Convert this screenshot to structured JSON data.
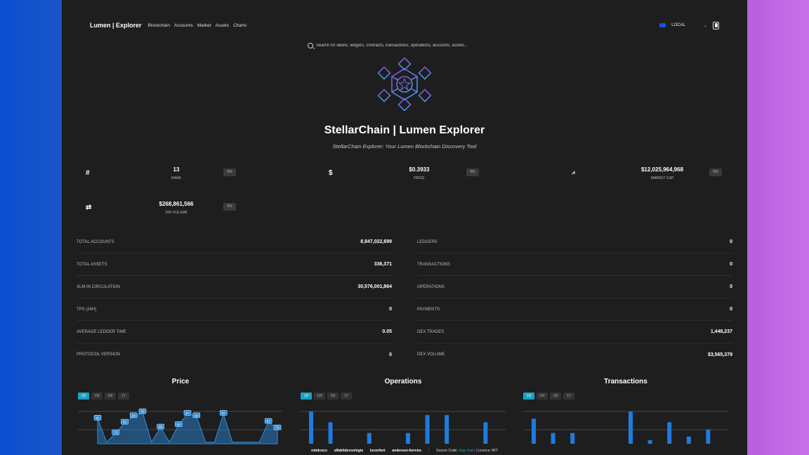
{
  "nav": {
    "brand": "Lumen | Explorer",
    "links": [
      "Blockchain",
      "Accounts",
      "Market",
      "Assets",
      "Charts"
    ],
    "network": "LOCAL"
  },
  "search": {
    "placeholder": "Search for labels, ledgers, contracts, transactions, operations, accounts, assets..."
  },
  "hero": {
    "title": "StellarChain | Lumen Explorer",
    "subtitle": "StellarChain Explorer: Your Lumen Blockchain Discovery Tool"
  },
  "stats": [
    {
      "icon": "hash-icon",
      "glyph": "#",
      "value": "13",
      "label": "RANK",
      "change": "0%"
    },
    {
      "icon": "dollar-icon",
      "glyph": "$",
      "value": "$0.3933",
      "label": "PRICE",
      "change": "0%"
    },
    {
      "icon": "chart-line-icon",
      "glyph": "📈",
      "value": "$12,025,964,968",
      "label": "MARKET CAP",
      "change": "0%"
    },
    {
      "icon": "exchange-icon",
      "glyph": "⇄",
      "value": "$268,861,566",
      "label": "24H VOLUME",
      "change": "0%"
    }
  ],
  "metrics_left": [
    {
      "label": "TOTAL ACCOUNTS",
      "value": "8,847,022,699"
    },
    {
      "label": "TOTAL ASSETS",
      "value": "336,371"
    },
    {
      "label": "XLM IN CIRCULATION",
      "value": "30,576,001,864"
    },
    {
      "label": "TPS (24H)",
      "value": "0"
    },
    {
      "label": "AVERAGE LEDGER TIME",
      "value": "0.05"
    },
    {
      "label": "PROTOCOL VERSION",
      "value": "0"
    }
  ],
  "metrics_right": [
    {
      "label": "LEDGERS",
      "value": "0"
    },
    {
      "label": "TRANSACTIONS",
      "value": "0"
    },
    {
      "label": "OPERATIONS",
      "value": "0"
    },
    {
      "label": "PAYMENTS",
      "value": "0"
    },
    {
      "label": "DEX TRADES",
      "value": "1,448,237"
    },
    {
      "label": "DEX VOLUME",
      "value": "$3,565,379"
    }
  ],
  "charts": {
    "ranges": [
      "1D",
      "1W",
      "1M",
      "1Y"
    ],
    "active_range": "1D",
    "price": {
      "title": "Price"
    },
    "operations": {
      "title": "Operations"
    },
    "transactions": {
      "title": "Transactions"
    }
  },
  "chart_data": [
    {
      "type": "area",
      "title": "Price",
      "labels": [
        "91",
        "73",
        "86",
        "94",
        "99",
        "80",
        "83",
        "97",
        "94",
        "97",
        "87",
        "79"
      ],
      "values": [
        91,
        62,
        73,
        86,
        94,
        99,
        62,
        80,
        62,
        83,
        97,
        94,
        62,
        62,
        97,
        62,
        62,
        62,
        62,
        87,
        79
      ],
      "color": "#2a8fe6"
    },
    {
      "type": "bar",
      "title": "Operations",
      "values": [
        9,
        6,
        0,
        3,
        0,
        3,
        8,
        8,
        0,
        6
      ],
      "color": "#1e7be0"
    },
    {
      "type": "bar",
      "title": "Transactions",
      "values": [
        7,
        3,
        3,
        0,
        0,
        9,
        1,
        6,
        2,
        4
      ],
      "color": "#1e7be0"
    }
  ],
  "footer": {
    "contributors": [
      "robdcoco",
      "alfabitdecnologia",
      "lucenfort",
      "anderson-ferreira"
    ],
    "source_prefix": "Source Code:",
    "source_link": "doja-chain",
    "license": "| Licence: MIT"
  }
}
